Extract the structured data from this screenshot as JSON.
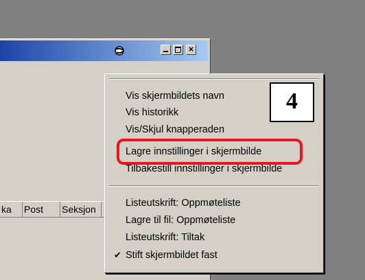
{
  "window": {
    "control_buttons": {
      "close_glyph": "×"
    },
    "columns": [
      "ka",
      "Post",
      "Seksjon"
    ]
  },
  "context_menu": {
    "items_group1": [
      "Vis skjermbildets navn",
      "Vis historikk",
      "Vis/Skjul knapperaden",
      "Lagre innstillinger i skjermbilde",
      "Tilbakestill innstillinger i skjermbilde"
    ],
    "items_group2": [
      "Listeutskrift: Oppmøteliste",
      "Lagre til fil: Oppmøteliste",
      "Listeutskrift: Tiltak",
      "Stift skjermbildet fast"
    ],
    "checked_item": "Stift skjermbildet fast",
    "checkmark": "✔"
  },
  "annotation": {
    "step_number": "4",
    "highlight_color": "#e8141e"
  }
}
